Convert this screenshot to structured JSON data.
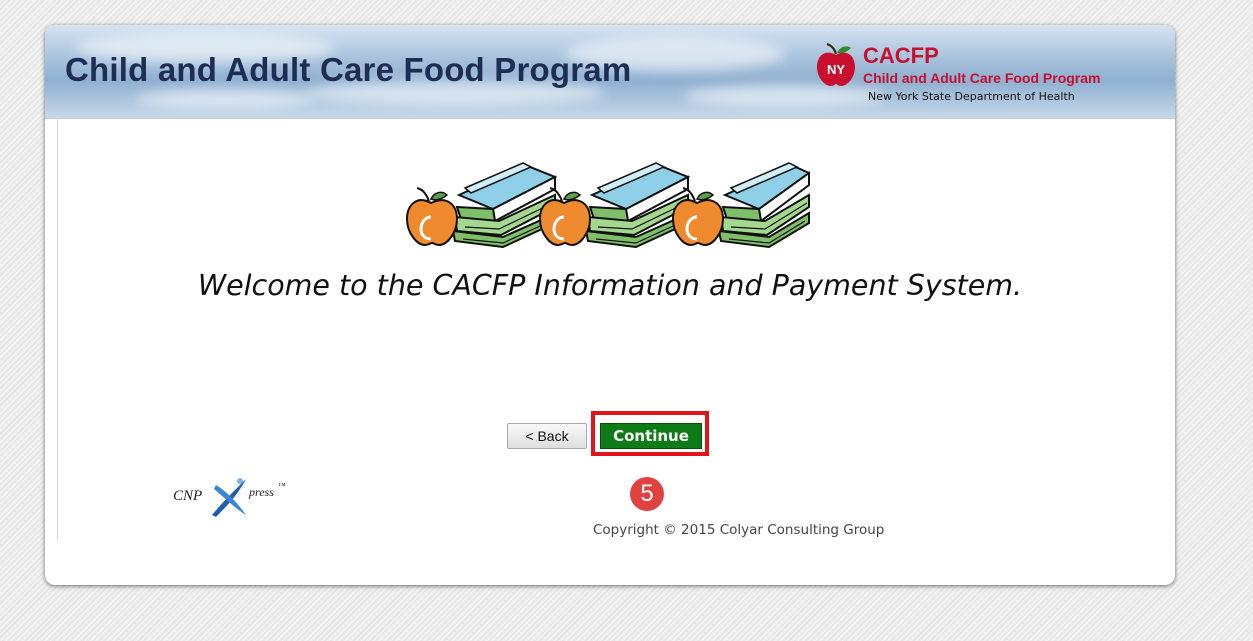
{
  "banner": {
    "title": "Child and Adult Care Food Program",
    "logo": {
      "badge": "NY",
      "acronym": "CACFP",
      "name": "Child and Adult Care Food Program",
      "department": "New York State Department of Health",
      "icon": "apple-icon"
    }
  },
  "main": {
    "illustration": "apples-and-books-illustration",
    "welcome": "Welcome to the CACFP Information and Payment System."
  },
  "actions": {
    "back_label": "< Back",
    "continue_label": "Continue",
    "step_badge": "5"
  },
  "footer": {
    "brand": {
      "prefix": "CNP",
      "suffix": "press",
      "trademark": "™"
    },
    "copyright": "Copyright © 2015 Colyar Consulting Group"
  },
  "colors": {
    "accent_red": "#c8102e",
    "continue_green": "#0f7a18",
    "highlight_red": "#e0141b",
    "badge_red": "#e04242",
    "title_navy": "#1f2d55"
  }
}
